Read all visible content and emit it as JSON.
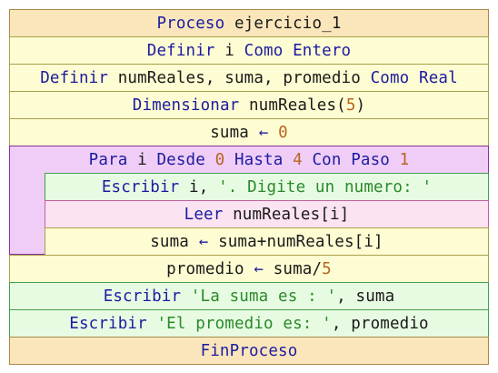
{
  "proceso": {
    "keyword": "Proceso",
    "name": "ejercicio_1"
  },
  "definir_i": {
    "keyword": "Definir",
    "vars": "i",
    "como": "Como",
    "type": "Entero"
  },
  "definir_reales": {
    "keyword": "Definir",
    "vars": "numReales, suma, promedio",
    "como": "Como",
    "type": "Real"
  },
  "dimensionar": {
    "keyword": "Dimensionar",
    "array": "numReales(",
    "size": "5",
    "close": ")"
  },
  "asignar_suma": {
    "var": "suma",
    "arrow": "←",
    "value": "0"
  },
  "para": {
    "keyword": "Para",
    "var": "i",
    "desde": "Desde",
    "start": "0",
    "hasta": "Hasta",
    "end": "4",
    "con_paso": "Con Paso",
    "step": "1"
  },
  "escribir_digite": {
    "keyword": "Escribir",
    "args_prefix": "i,",
    "string": "'. Digite un numero: '"
  },
  "leer": {
    "keyword": "Leer",
    "target": "numReales[i]"
  },
  "acumular": {
    "var": "suma",
    "arrow": "←",
    "expr": "suma+numReales[i]"
  },
  "asignar_promedio": {
    "var": "promedio",
    "arrow": "←",
    "expr": "suma/",
    "divisor": "5"
  },
  "escribir_suma": {
    "keyword": "Escribir",
    "string": "'La suma es : '",
    "rest": ", suma"
  },
  "escribir_promedio": {
    "keyword": "Escribir",
    "string": "'El promedio es: '",
    "rest": ", promedio"
  },
  "fin": {
    "keyword": "FinProceso"
  },
  "colors": {
    "keyword": "#1c1ca0",
    "number": "#b86420",
    "string": "#2a8a2a",
    "process_block": "#fbe6bb",
    "statement_block": "#fefcd2",
    "write_block": "#e7fbe3",
    "read_block": "#fbe3f1",
    "loop_block": "#f0cdf7"
  }
}
